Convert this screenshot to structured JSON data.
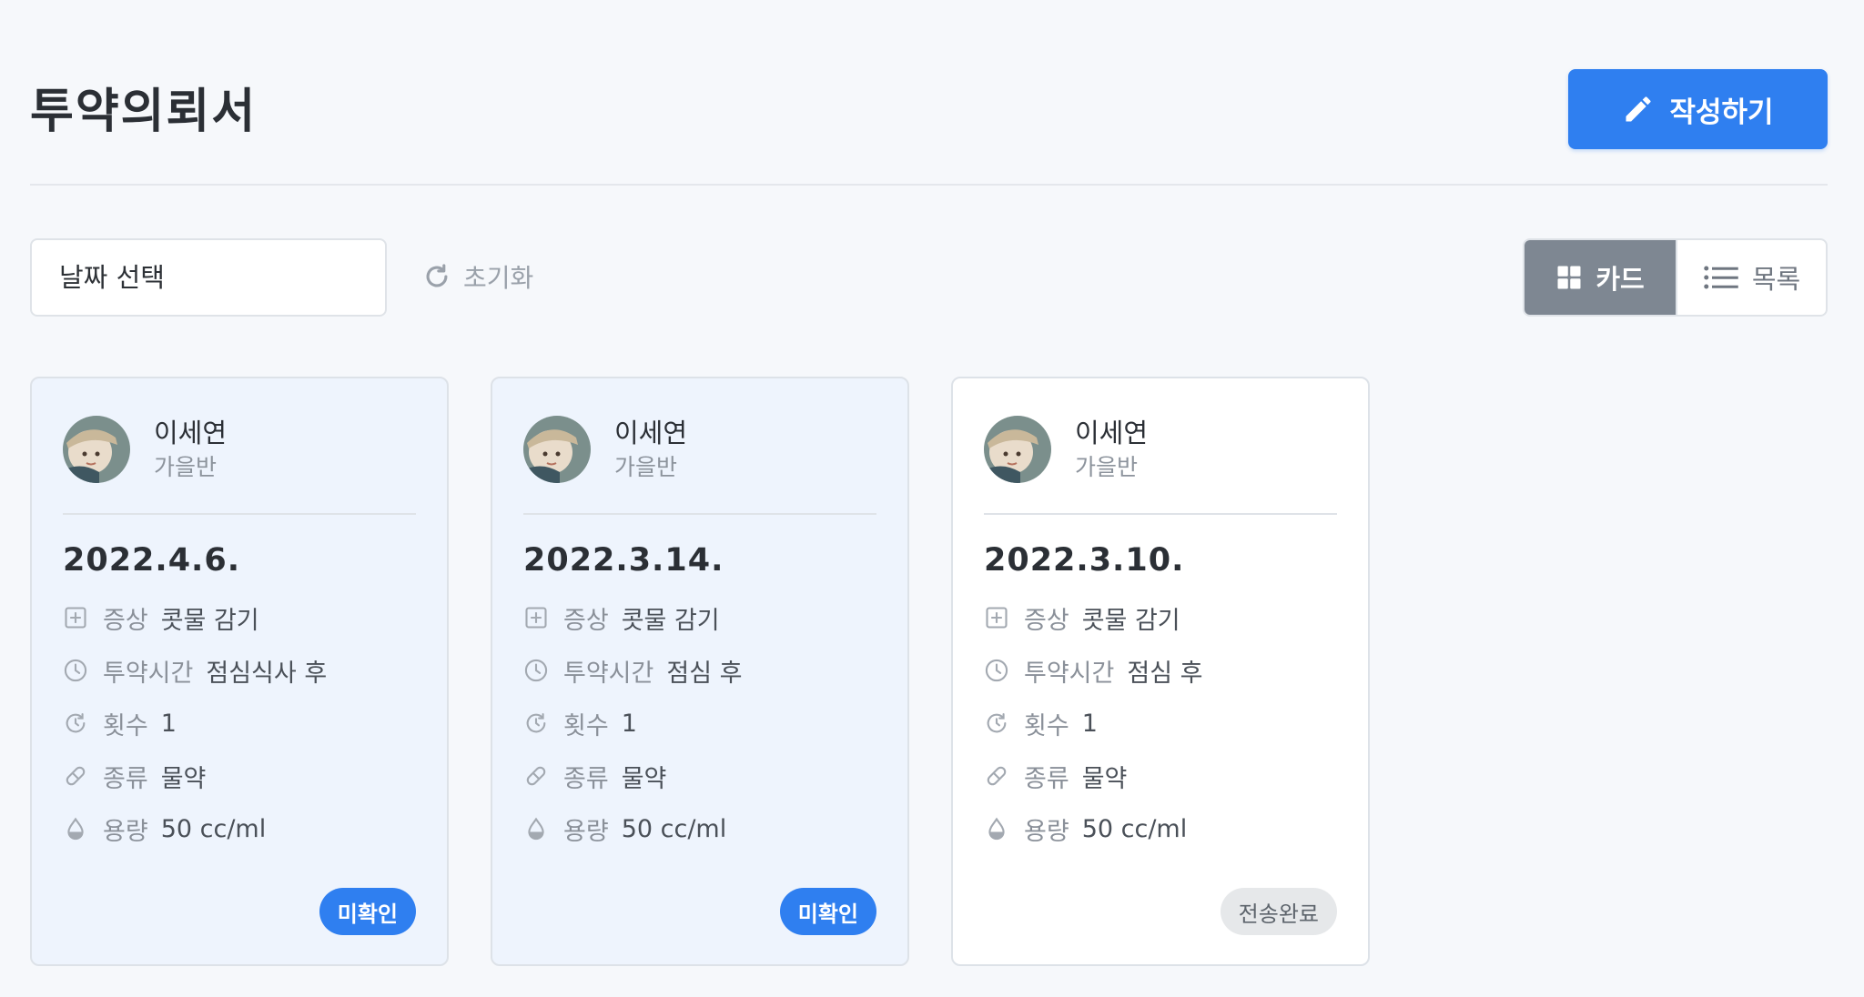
{
  "header": {
    "title": "투약의뢰서",
    "write_button_label": "작성하기",
    "accent_color": "#2f7ff0"
  },
  "toolbar": {
    "date_placeholder": "날짜 선택",
    "reset_label": "초기화",
    "view_toggle": {
      "card_label": "카드",
      "list_label": "목록",
      "selected": "card"
    }
  },
  "cards": [
    {
      "name": "이세연",
      "class": "가을반",
      "date": "2022.4.6.",
      "symptom_label": "증상",
      "symptom": "콧물 감기",
      "time_label": "투약시간",
      "time": "점심식사 후",
      "count_label": "횟수",
      "count": "1",
      "type_label": "종류",
      "type": "물약",
      "dose_label": "용량",
      "dose": "50 cc/ml",
      "status": "미확인"
    },
    {
      "name": "이세연",
      "class": "가을반",
      "date": "2022.3.14.",
      "symptom_label": "증상",
      "symptom": "콧물 감기",
      "time_label": "투약시간",
      "time": "점심 후",
      "count_label": "횟수",
      "count": "1",
      "type_label": "종류",
      "type": "물약",
      "dose_label": "용량",
      "dose": "50 cc/ml",
      "status": "미확인"
    },
    {
      "name": "이세연",
      "class": "가을반",
      "date": "2022.3.10.",
      "symptom_label": "증상",
      "symptom": "콧물 감기",
      "time_label": "투약시간",
      "time": "점심 후",
      "count_label": "횟수",
      "count": "1",
      "type_label": "종류",
      "type": "물약",
      "dose_label": "용량",
      "dose": "50 cc/ml",
      "status": "전송완료"
    }
  ]
}
